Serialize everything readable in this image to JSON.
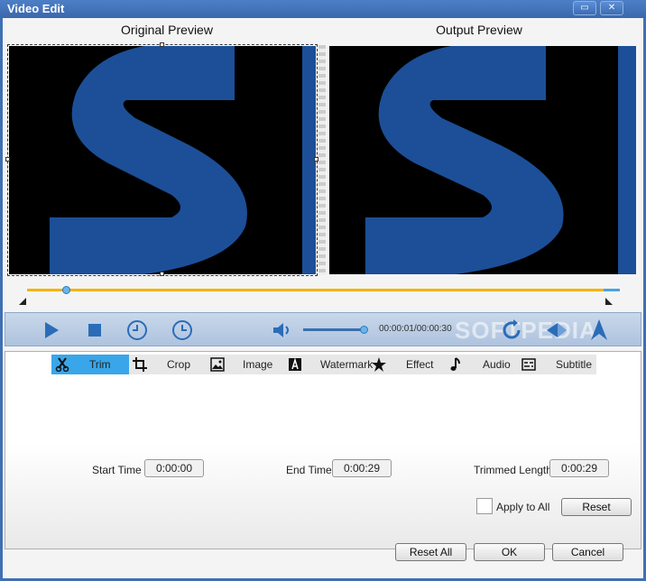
{
  "window": {
    "title": "Video Edit",
    "maximize_glyph": "▭",
    "close_glyph": "✕"
  },
  "preview": {
    "original_label": "Original Preview",
    "output_label": "Output Preview",
    "logo_color": "#1c4f98"
  },
  "timeline": {
    "progress": 0.05,
    "accent": "#f4b400"
  },
  "controls": {
    "icons": [
      "play-icon",
      "stop-icon",
      "clock-icon",
      "clock-icon",
      "volume-icon"
    ],
    "volume_level": 0.95,
    "time": "00:00:01/00:00:30",
    "watermark": "SOFTPEDIA"
  },
  "tabs": [
    {
      "label": "Trim",
      "icon": "scissors-icon",
      "active": true
    },
    {
      "label": "Crop",
      "icon": "crop-icon",
      "active": false
    },
    {
      "label": "Image",
      "icon": "image-icon",
      "active": false
    },
    {
      "label": "Watermark",
      "icon": "watermark-icon",
      "active": false
    },
    {
      "label": "Effect",
      "icon": "star-icon",
      "active": false
    },
    {
      "label": "Audio",
      "icon": "music-note-icon",
      "active": false
    },
    {
      "label": "Subtitle",
      "icon": "subtitle-icon",
      "active": false
    }
  ],
  "trim": {
    "start_label": "Start Time",
    "start_value": "0:00:00",
    "end_label": "End Time",
    "end_value": "0:00:29",
    "length_label": "Trimmed Length",
    "length_value": "0:00:29",
    "apply_all_label": "Apply to All",
    "reset_label": "Reset"
  },
  "footer": {
    "reset_all_label": "Reset All",
    "ok_label": "OK",
    "cancel_label": "Cancel"
  }
}
